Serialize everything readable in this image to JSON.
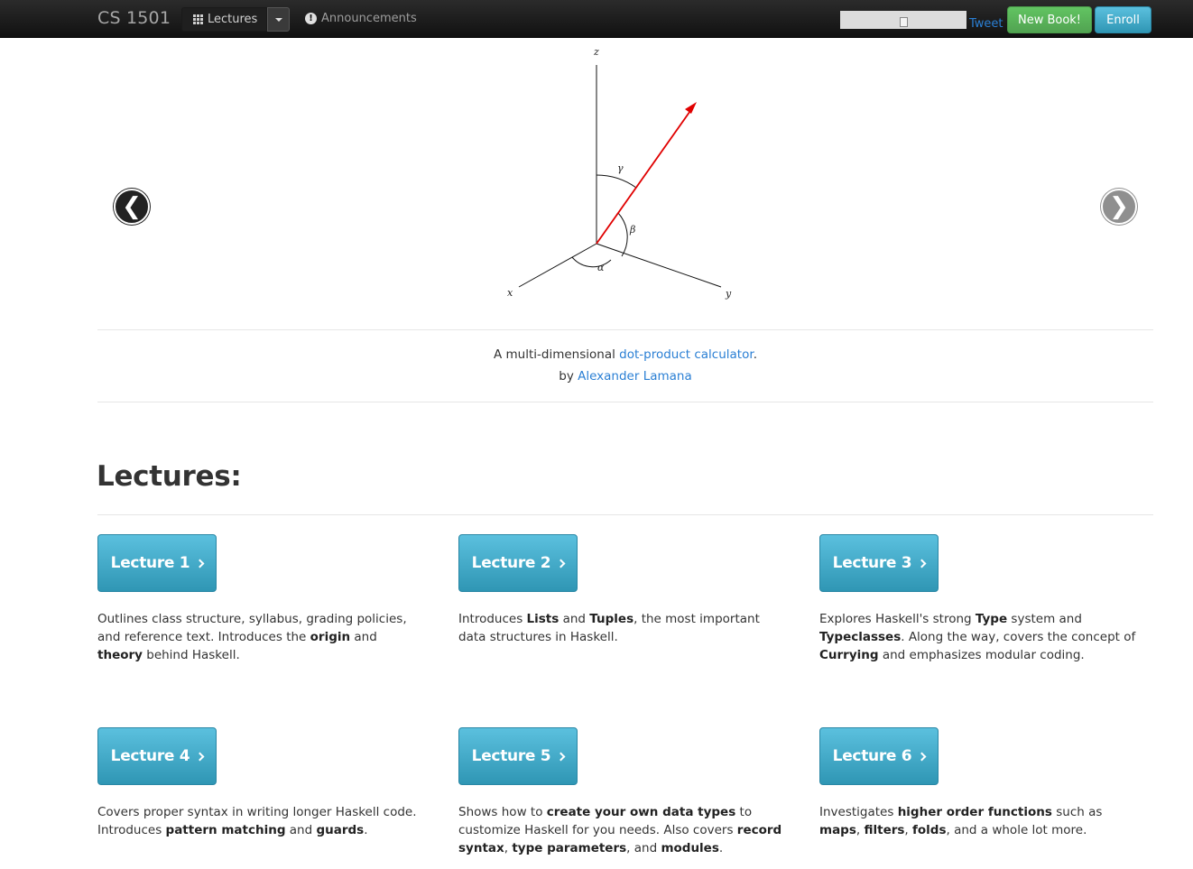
{
  "navbar": {
    "brand": "CS 1501",
    "lectures_label": "Lectures",
    "announcements_label": "Announcements",
    "tweet_label": "Tweet",
    "new_book_label": "New Book!",
    "enroll_label": "Enroll",
    "colors": {
      "new_book": "#5bb75b",
      "enroll": "#49afcd"
    }
  },
  "carousel": {
    "prev_glyph": "❮",
    "next_glyph": "❯",
    "diagram": {
      "axis_labels": {
        "z": "z",
        "x": "x",
        "y": "y"
      },
      "angle_labels": {
        "gamma": "γ",
        "beta": "β",
        "alpha": "α"
      },
      "vector_color": "#e00000"
    },
    "caption": {
      "prefix": "A multi-dimensional ",
      "link": "dot-product calculator",
      "suffix": ".",
      "by_prefix": "by ",
      "author": "Alexander Lamana"
    }
  },
  "lectures": {
    "heading": "Lectures:",
    "items": [
      {
        "label": "Lecture 1",
        "parts": [
          {
            "t": "Outlines class structure, syllabus, grading policies, and reference text. Introduces the "
          },
          {
            "t": "origin",
            "b": true
          },
          {
            "t": " and "
          },
          {
            "t": "theory",
            "b": true
          },
          {
            "t": " behind Haskell."
          }
        ]
      },
      {
        "label": "Lecture 2",
        "parts": [
          {
            "t": "Introduces "
          },
          {
            "t": "Lists",
            "b": true
          },
          {
            "t": " and "
          },
          {
            "t": "Tuples",
            "b": true
          },
          {
            "t": ", the most important data structures in Haskell."
          }
        ]
      },
      {
        "label": "Lecture 3",
        "parts": [
          {
            "t": "Explores Haskell's strong "
          },
          {
            "t": "Type",
            "b": true
          },
          {
            "t": " system and "
          },
          {
            "t": "Typeclasses",
            "b": true
          },
          {
            "t": ". Along the way, covers the concept of "
          },
          {
            "t": "Currying",
            "b": true
          },
          {
            "t": " and emphasizes modular coding."
          }
        ]
      },
      {
        "label": "Lecture 4",
        "parts": [
          {
            "t": "Covers proper syntax in writing longer Haskell code. Introduces "
          },
          {
            "t": "pattern matching",
            "b": true
          },
          {
            "t": " and "
          },
          {
            "t": "guards",
            "b": true
          },
          {
            "t": "."
          }
        ]
      },
      {
        "label": "Lecture 5",
        "parts": [
          {
            "t": "Shows how to "
          },
          {
            "t": "create your own data types",
            "b": true
          },
          {
            "t": " to customize Haskell for you needs. Also covers "
          },
          {
            "t": "record syntax",
            "b": true
          },
          {
            "t": ", "
          },
          {
            "t": "type parameters",
            "b": true
          },
          {
            "t": ", and "
          },
          {
            "t": "modules",
            "b": true
          },
          {
            "t": "."
          }
        ]
      },
      {
        "label": "Lecture 6",
        "parts": [
          {
            "t": "Investigates "
          },
          {
            "t": "higher order functions",
            "b": true
          },
          {
            "t": " such as "
          },
          {
            "t": "maps",
            "b": true
          },
          {
            "t": ", "
          },
          {
            "t": "filters",
            "b": true
          },
          {
            "t": ", "
          },
          {
            "t": "folds",
            "b": true
          },
          {
            "t": ", and a whole lot more."
          }
        ]
      }
    ]
  }
}
